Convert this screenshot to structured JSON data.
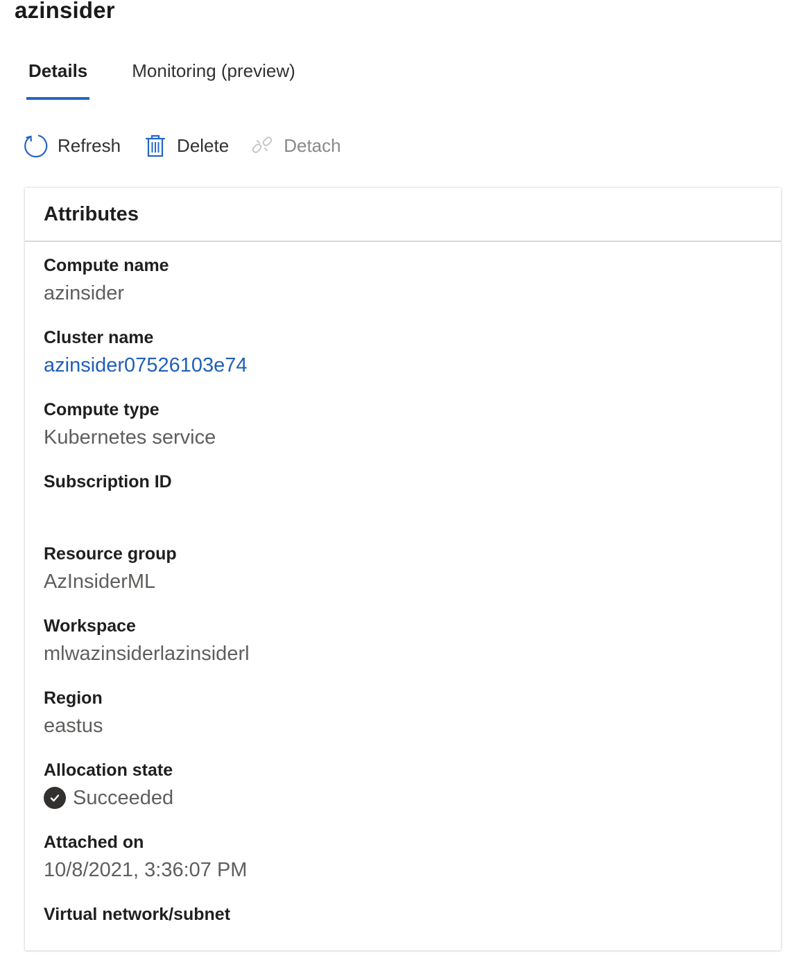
{
  "page": {
    "title": "azinsider"
  },
  "tabs": [
    {
      "label": "Details",
      "active": true
    },
    {
      "label": "Monitoring (preview)",
      "active": false
    }
  ],
  "toolbar": {
    "refresh_label": "Refresh",
    "refresh_icon": "refresh-icon",
    "delete_label": "Delete",
    "delete_icon": "trash-icon",
    "detach_label": "Detach",
    "detach_icon": "unlink-icon",
    "detach_disabled": true
  },
  "attributes": {
    "title": "Attributes",
    "compute_name": {
      "label": "Compute name",
      "value": "azinsider"
    },
    "cluster_name": {
      "label": "Cluster name",
      "value": "azinsider07526103e74"
    },
    "compute_type": {
      "label": "Compute type",
      "value": "Kubernetes service"
    },
    "subscription_id": {
      "label": "Subscription ID",
      "value": ""
    },
    "resource_group": {
      "label": "Resource group",
      "value": "AzInsiderML"
    },
    "workspace": {
      "label": "Workspace",
      "value": "mlwazinsiderlazinsiderl"
    },
    "region": {
      "label": "Region",
      "value": "eastus"
    },
    "allocation_state": {
      "label": "Allocation state",
      "value": "Succeeded",
      "icon": "check-circle-icon"
    },
    "attached_on": {
      "label": "Attached on",
      "value": "10/8/2021, 3:36:07 PM"
    },
    "virtual_network": {
      "label": "Virtual network/subnet",
      "value": ""
    }
  },
  "colors": {
    "accent": "#2266c6",
    "link": "#1f5fb8",
    "text": "#201f1e",
    "muted": "#605e5c",
    "disabled": "#8a8886"
  }
}
